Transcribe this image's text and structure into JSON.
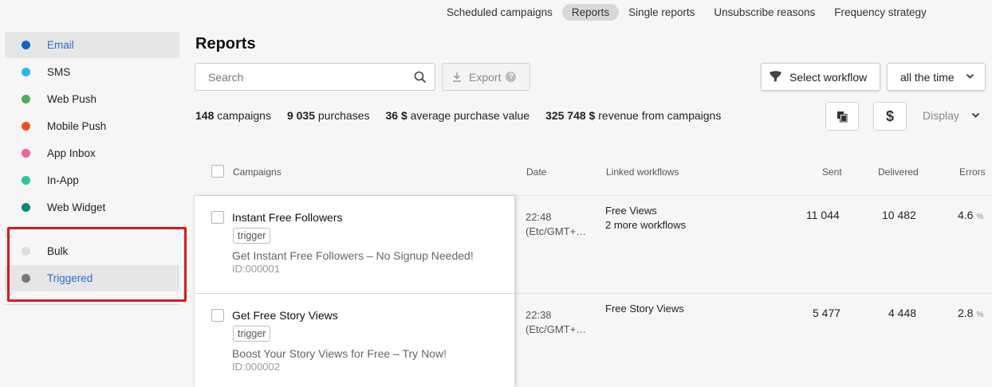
{
  "topnav": {
    "items": [
      {
        "label": "Scheduled campaigns",
        "active": false
      },
      {
        "label": "Reports",
        "active": true
      },
      {
        "label": "Single reports",
        "active": false
      },
      {
        "label": "Unsubscribe reasons",
        "active": false
      },
      {
        "label": "Frequency strategy",
        "active": false
      }
    ]
  },
  "sidebar": {
    "items": [
      {
        "label": "Email",
        "color": "#1565c0",
        "active": true
      },
      {
        "label": "SMS",
        "color": "#29b6f6",
        "active": false
      },
      {
        "label": "Web Push",
        "color": "#4caf50",
        "active": false
      },
      {
        "label": "Mobile Push",
        "color": "#f4511e",
        "active": false
      },
      {
        "label": "App Inbox",
        "color": "#f06292",
        "active": false
      },
      {
        "label": "In-App",
        "color": "#26c6a0",
        "active": false
      },
      {
        "label": "Web Widget",
        "color": "#00897b",
        "active": false
      }
    ],
    "type_items": [
      {
        "label": "Bulk",
        "color": "#dddddd",
        "active": false
      },
      {
        "label": "Triggered",
        "color": "#777777",
        "active": true
      }
    ],
    "highlight_color": "#e01818"
  },
  "main": {
    "title": "Reports",
    "search_placeholder": "Search",
    "export_label": "Export",
    "export_help": "?",
    "select_workflow_label": "Select workflow",
    "period_label": "all the time",
    "display_label": "Display",
    "stats": [
      {
        "value": "148",
        "label": "campaigns"
      },
      {
        "value": "9 035",
        "label": "purchases"
      },
      {
        "value": "36 $",
        "label": "average purchase value"
      },
      {
        "value": "325 748 $",
        "label": "revenue from campaigns"
      }
    ],
    "currency_symbol": "$"
  },
  "table": {
    "columns": [
      "Campaigns",
      "Date",
      "Linked workflows",
      "Sent",
      "Delivered",
      "Errors"
    ],
    "rows": [
      {
        "name": "Instant Free Followers",
        "tag": "trigger",
        "description": "Get Instant Free Followers – No Signup Needed!",
        "id": "ID:000001",
        "date_time": "22:48",
        "date_tz": "(Etc/GMT+…",
        "workflow": "Free Views",
        "workflow_more": "2 more workflows",
        "sent": "11 044",
        "delivered": "10 482",
        "errors": "4.6",
        "errors_unit": "%"
      },
      {
        "name": "Get Free Story Views",
        "tag": "trigger",
        "description": "Boost Your Story Views for Free – Try Now!",
        "id": "ID:000002",
        "date_time": "22:38",
        "date_tz": "(Etc/GMT+…",
        "workflow": "Free Story Views",
        "workflow_more": "",
        "sent": "5 477",
        "delivered": "4 448",
        "errors": "2.8",
        "errors_unit": "%"
      }
    ]
  }
}
